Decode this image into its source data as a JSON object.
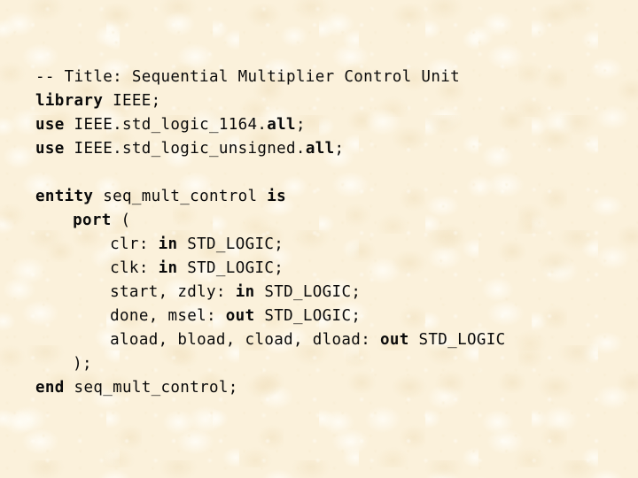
{
  "slide": {
    "kind": "vhdl-code-slide",
    "title_comment": "-- Title: Sequential Multiplier Control Unit",
    "entity_name": "seq_mult_control",
    "colors": {
      "background": "#fbf1db",
      "background_light_blotch": "#fffdf6",
      "background_dark_blotch": "#f4e6c8",
      "text": "#0a0a0a"
    },
    "code_lines": [
      {
        "id": "line-title-comment",
        "indent": 0,
        "segments": [
          {
            "text": "-- Title: Sequential Multiplier Control Unit",
            "bold": false
          }
        ]
      },
      {
        "id": "line-library-ieee",
        "indent": 0,
        "segments": [
          {
            "text": "library",
            "bold": true
          },
          {
            "text": " IEEE;",
            "bold": false
          }
        ]
      },
      {
        "id": "line-use-std-logic-1164",
        "indent": 0,
        "segments": [
          {
            "text": "use",
            "bold": true
          },
          {
            "text": " IEEE.std_logic_1164.",
            "bold": false
          },
          {
            "text": "all",
            "bold": true
          },
          {
            "text": ";",
            "bold": false
          }
        ]
      },
      {
        "id": "line-use-std-logic-unsigned",
        "indent": 0,
        "segments": [
          {
            "text": "use",
            "bold": true
          },
          {
            "text": " IEEE.std_logic_unsigned.",
            "bold": false
          },
          {
            "text": "all",
            "bold": true
          },
          {
            "text": ";",
            "bold": false
          }
        ]
      },
      {
        "id": "line-blank-1",
        "indent": 0,
        "segments": []
      },
      {
        "id": "line-entity-declaration",
        "indent": 0,
        "segments": [
          {
            "text": "entity",
            "bold": true
          },
          {
            "text": " seq_mult_control ",
            "bold": false
          },
          {
            "text": "is",
            "bold": true
          }
        ]
      },
      {
        "id": "line-port-open",
        "indent": 4,
        "segments": [
          {
            "text": "port",
            "bold": true
          },
          {
            "text": " (",
            "bold": false
          }
        ]
      },
      {
        "id": "line-port-clr",
        "indent": 8,
        "segments": [
          {
            "text": "clr: ",
            "bold": false
          },
          {
            "text": "in",
            "bold": true
          },
          {
            "text": " STD_LOGIC;",
            "bold": false
          }
        ]
      },
      {
        "id": "line-port-clk",
        "indent": 8,
        "segments": [
          {
            "text": "clk: ",
            "bold": false
          },
          {
            "text": "in",
            "bold": true
          },
          {
            "text": " STD_LOGIC;",
            "bold": false
          }
        ]
      },
      {
        "id": "line-port-start-zdly",
        "indent": 8,
        "segments": [
          {
            "text": "start, zdly: ",
            "bold": false
          },
          {
            "text": "in",
            "bold": true
          },
          {
            "text": " STD_LOGIC;",
            "bold": false
          }
        ]
      },
      {
        "id": "line-port-done-msel",
        "indent": 8,
        "segments": [
          {
            "text": "done, msel: ",
            "bold": false
          },
          {
            "text": "out",
            "bold": true
          },
          {
            "text": " STD_LOGIC;",
            "bold": false
          }
        ]
      },
      {
        "id": "line-port-loads",
        "indent": 8,
        "segments": [
          {
            "text": "aload, bload, cload, dload: ",
            "bold": false
          },
          {
            "text": "out",
            "bold": true
          },
          {
            "text": " STD_LOGIC",
            "bold": false
          }
        ]
      },
      {
        "id": "line-port-close",
        "indent": 4,
        "segments": [
          {
            "text": ");",
            "bold": false
          }
        ]
      },
      {
        "id": "line-end-entity",
        "indent": 0,
        "segments": [
          {
            "text": "end",
            "bold": true
          },
          {
            "text": " seq_mult_control;",
            "bold": false
          }
        ]
      }
    ]
  }
}
